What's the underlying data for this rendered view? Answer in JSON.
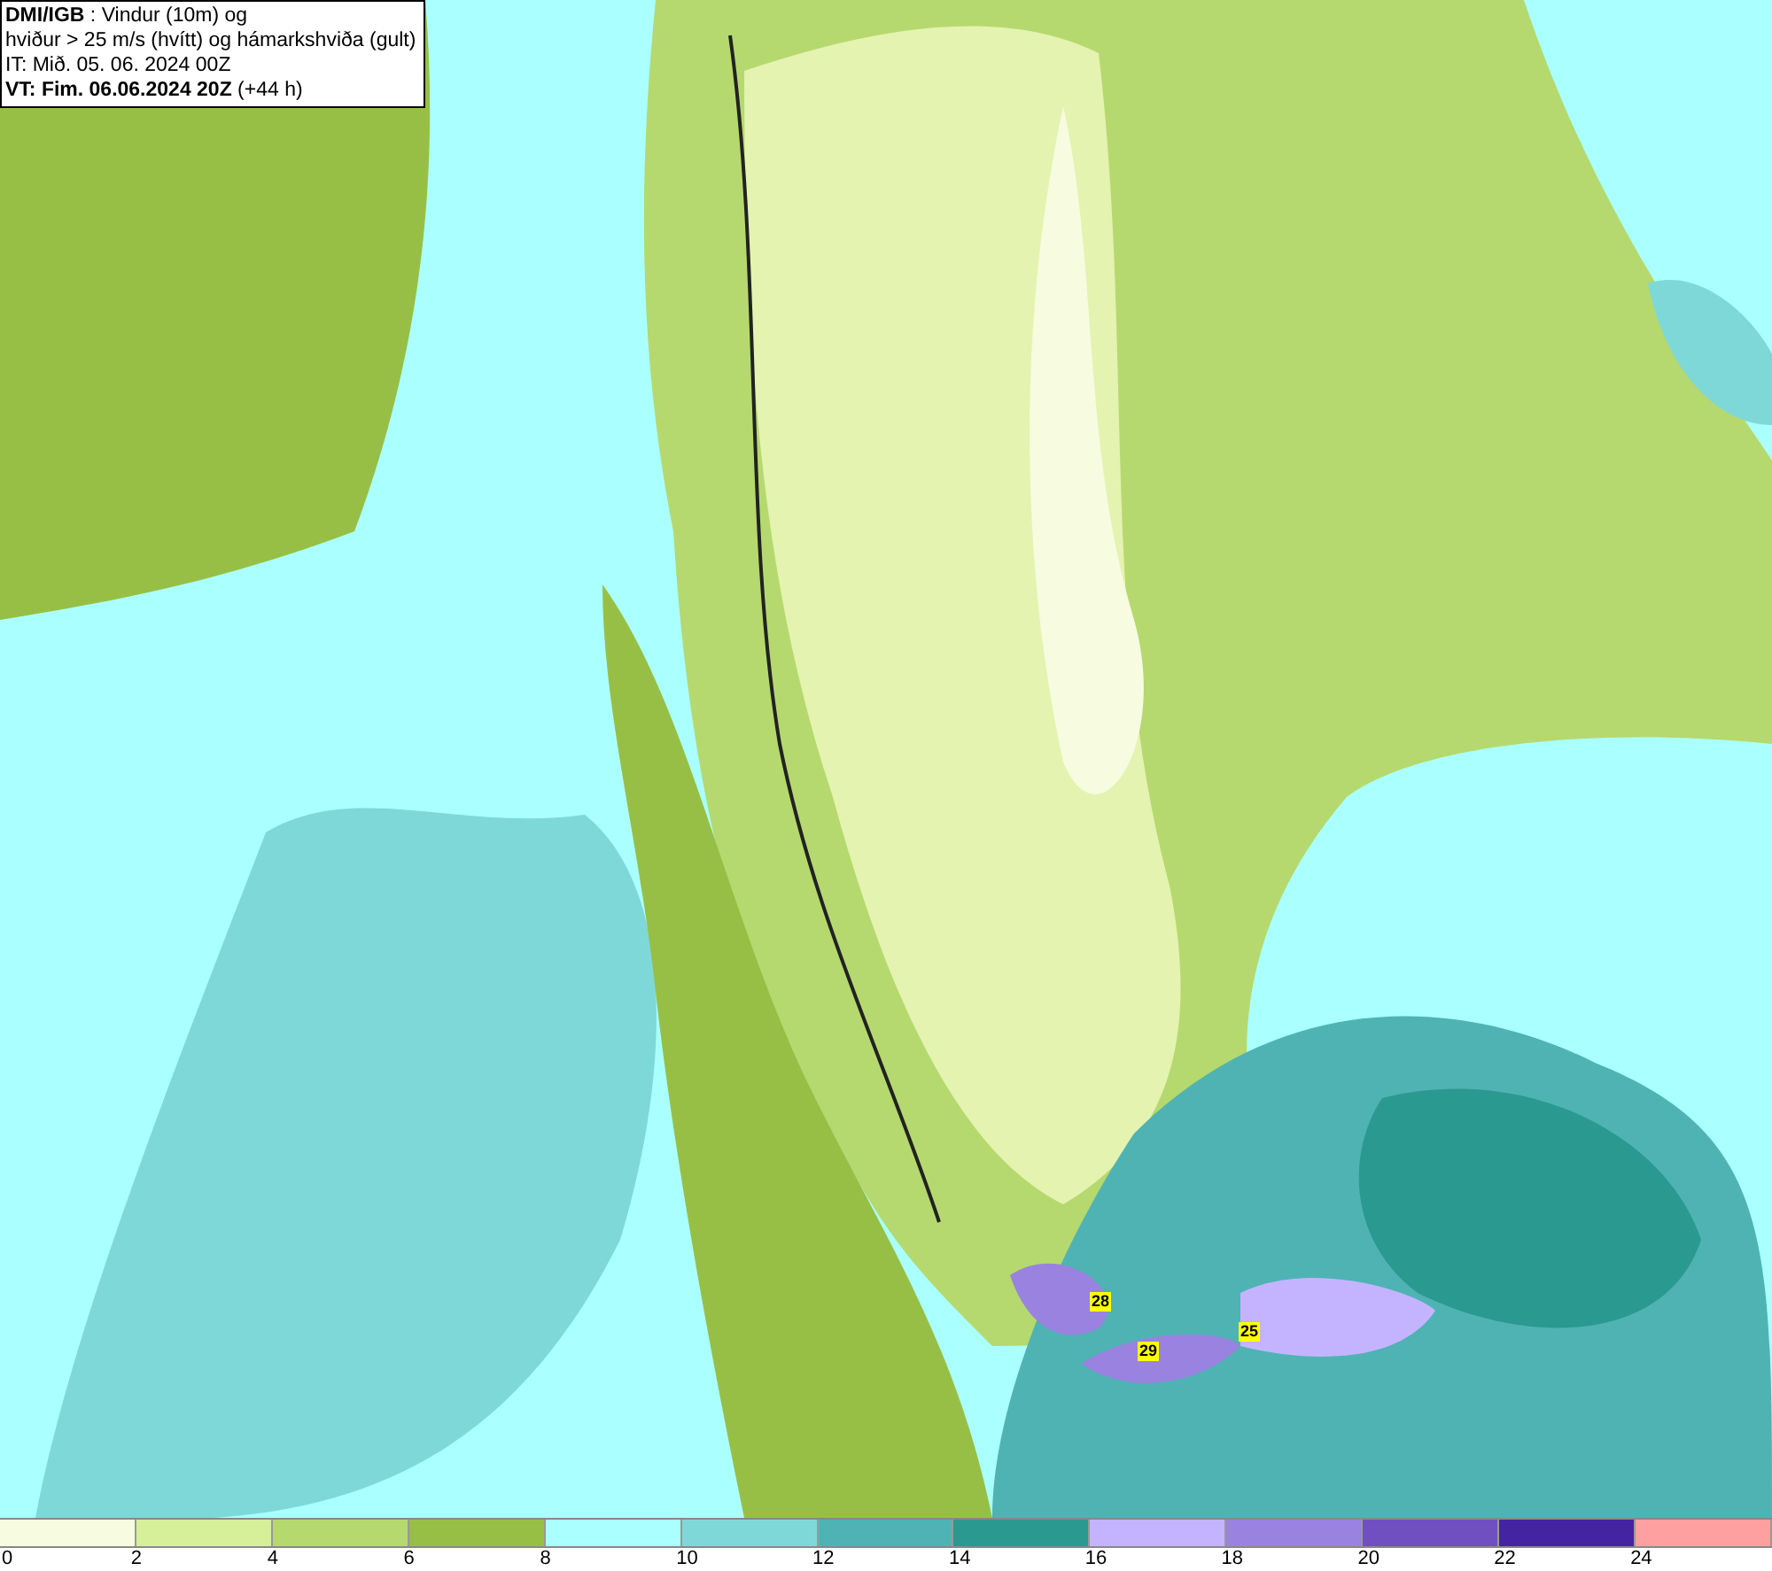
{
  "header": {
    "lines": [
      "**DMI/IGB** : Vindur (10m) og",
      "hviður > 25 m/s (hvítt) og hámarkshviða (gult)",
      "IT: Mið. 05. 06. 2024 00Z",
      "**VT: Fim. 06.06.2024 20Z** (+44 h)"
    ]
  },
  "gust_labels": [
    {
      "text": "28"
    },
    {
      "text": "29"
    },
    {
      "text": "25"
    }
  ],
  "legend": {
    "bins": [
      {
        "color": "#f7fbe0"
      },
      {
        "color": "#d6f09a"
      },
      {
        "color": "#b5d96e"
      },
      {
        "color": "#98bf45"
      },
      {
        "color": "#aaffff"
      },
      {
        "color": "#7fd8d8"
      },
      {
        "color": "#4fb3b3"
      },
      {
        "color": "#2a9990"
      },
      {
        "color": "#c4b4ff"
      },
      {
        "color": "#9a82e0"
      },
      {
        "color": "#7050c0"
      },
      {
        "color": "#4424a0"
      },
      {
        "color": "#ffa0a0"
      }
    ],
    "ticks": [
      "0",
      "2",
      "4",
      "6",
      "8",
      "10",
      "12",
      "14",
      "16",
      "18",
      "20",
      "22",
      "24"
    ]
  }
}
